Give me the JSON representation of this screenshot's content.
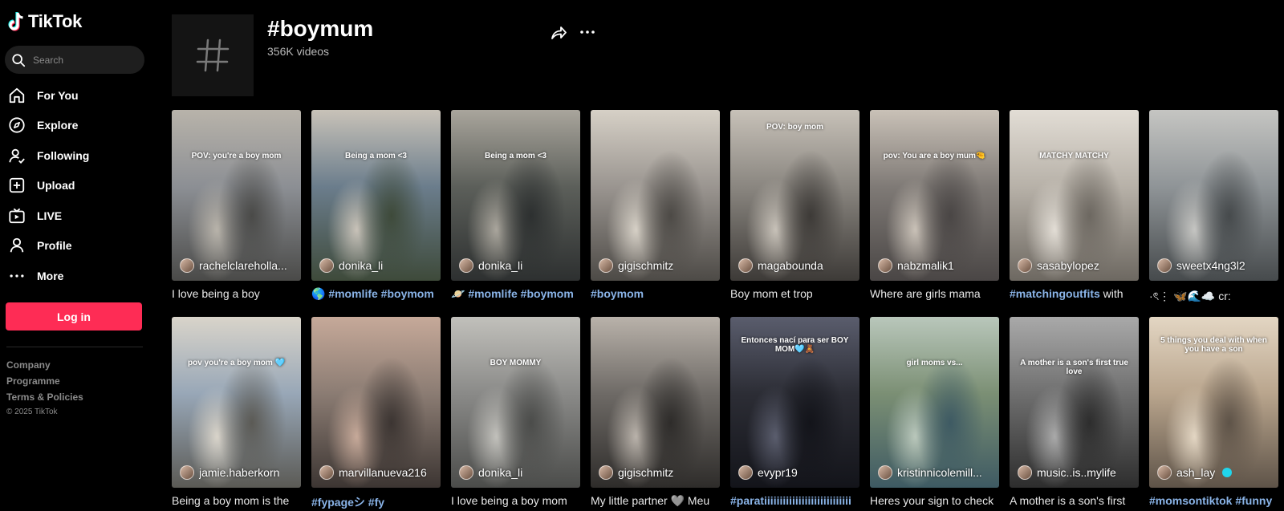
{
  "app": {
    "name": "TikTok"
  },
  "search": {
    "placeholder": "Search"
  },
  "nav": [
    {
      "label": "For You",
      "icon": "home-icon"
    },
    {
      "label": "Explore",
      "icon": "compass-icon"
    },
    {
      "label": "Following",
      "icon": "following-icon"
    },
    {
      "label": "Upload",
      "icon": "upload-icon"
    },
    {
      "label": "LIVE",
      "icon": "live-icon"
    },
    {
      "label": "Profile",
      "icon": "profile-icon"
    },
    {
      "label": "More",
      "icon": "more-icon"
    }
  ],
  "login": {
    "label": "Log in"
  },
  "footer": {
    "links": [
      "Company",
      "Programme",
      "Terms & Policies"
    ],
    "copyright": "© 2025 TikTok"
  },
  "header": {
    "title": "#boymum",
    "count": "356K videos"
  },
  "colors": {
    "accent": "#fe2c55",
    "hashtag": "#8ab4e8"
  },
  "videos": [
    {
      "author": "rachelclareholla...",
      "caption": "I love being a boy",
      "overlay": "POV: you're a boy mom",
      "caption_style": "plain"
    },
    {
      "author": "donika_li",
      "caption": "🌎 #momlife #boymom",
      "overlay": "Being a mom <3",
      "caption_style": "tag"
    },
    {
      "author": "donika_li",
      "caption": "🪐 #momlife #boymom",
      "overlay": "Being a mom <3",
      "caption_style": "tag"
    },
    {
      "author": "gigischmitz",
      "caption": "#boymom",
      "overlay": "",
      "caption_style": "tag"
    },
    {
      "author": "magabounda",
      "caption": "Boy mom et trop",
      "overlay": "POV: boy mom",
      "caption_style": "plain"
    },
    {
      "author": "nabzmalik1",
      "caption": "Where are girls mama",
      "overlay": "pov: You are a boy mum🤏",
      "caption_style": "plain"
    },
    {
      "author": "sasabylopez",
      "caption": "#matchingoutfits with",
      "overlay": "MATCHY MATCHY",
      "caption_style": "mixed"
    },
    {
      "author": "sweetx4ng3l2",
      "caption": "·ৎ⋮ 🦋🌊☁️ cr:",
      "overlay": "",
      "caption_style": "plain"
    },
    {
      "author": "jamie.haberkorn",
      "caption": "Being a boy mom is the",
      "overlay": "pov you're a boy mom 🩵",
      "caption_style": "plain"
    },
    {
      "author": "marvillanueva216",
      "caption": "#fypageシ #fy",
      "overlay": "",
      "caption_style": "tag"
    },
    {
      "author": "donika_li",
      "caption": "I love being a boy mom",
      "overlay": "BOY MOMMY",
      "caption_style": "plain"
    },
    {
      "author": "gigischmitz",
      "caption": "My little partner 🩶 Meu",
      "overlay": "",
      "caption_style": "plain"
    },
    {
      "author": "evypr19",
      "caption": "#paratiiiiiiiiiiiiiiiiiiiiiiiiiiii",
      "overlay": "Entonces nací para ser BOY MOM🩵🧸",
      "caption_style": "tag"
    },
    {
      "author": "kristinnicolemill...",
      "caption": "Heres your sign to check",
      "overlay": "girl moms vs...",
      "caption_style": "plain"
    },
    {
      "author": "music..is..mylife",
      "caption": "A mother is a son's first",
      "overlay": "A mother is a son's first true love",
      "caption_style": "plain"
    },
    {
      "author": "ash_lay",
      "caption": "#momsontiktok #funny",
      "overlay": "5 things you deal with when you have a son",
      "caption_style": "tag",
      "verified": true
    }
  ]
}
